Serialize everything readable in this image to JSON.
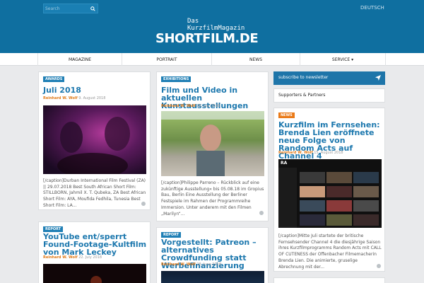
{
  "header": {
    "search_placeholder": "Search",
    "language": "DEUTSCH",
    "logo_line1": "Das",
    "logo_line2": "KurzfilmMagazin",
    "logo_big": "SHORTFILM.DE"
  },
  "nav": [
    "MAGAZINE",
    "PORTRAIT",
    "NEWS",
    "SERVICE ▾"
  ],
  "cards": {
    "c1": {
      "badge": "AWARDS",
      "title": "Juli 2018",
      "author": "Reinhard W. Wolf",
      "date": "9. August 2018",
      "excerpt": "[/caption]Durban International Film Festival (ZA) || 29.07.2018 Best South African Short Film: STILLBORN, Jahmil X. T. Qubeka, ZA Best African Short Film: AYA, Moufida Fedhila, Tunesia Best Short Film: LA..."
    },
    "c2": {
      "badge": "EXHIBITIONS",
      "title": "Film und Video in aktuellen Kunstausstellungen",
      "author": "Reinhard W. Wolf",
      "date": "28. July 2018",
      "excerpt": "[/caption]Philippe Parreno – Rückblick auf eine zukünftige Ausstellung« bis 05.08.18 im Gropius Bau, Berlin Eine Ausstellung der Berliner Festspiele im Rahmen der Programmreihe Immersion. Unter anderem mit den Filmen „Marilyn“..."
    },
    "c3": {
      "badge": "REPORT",
      "title": "YouTube ent/sperrt Found-Footage-Kultfilm von Mark Leckey",
      "author": "Reinhard W. Wolf",
      "date": "22. July 2018"
    },
    "c4": {
      "badge": "REPORT",
      "title": "Vorgestellt: Patreon – alternatives Crowdfunding statt Werbefinanzierung",
      "author": "Reinhard W. Wolf",
      "date": "28. June 2018"
    },
    "c5": {
      "badge": "NEWS",
      "title": "Kurzfilm im Fernsehen: Brenda Lien eröffnete neue Folge von Random Acts auf Channel 4",
      "author": "Reinhard W. Wolf",
      "date": "15. August 2018",
      "excerpt": "[/caption]Mitte Juli startete der britische Fernsehsender Channel 4 die diesjährige Saison ihres Kurzfilmprogramms Random Acts mit CALL OF CUTENESS der Offenbacher Filmemacherin Brenda Lien. Die animierte, gruselige Abrechnung mit der..."
    }
  },
  "sidebar": {
    "newsletter": "subscribe to newsletter",
    "supporters": "Supporters & Partners",
    "ra_label": "RA"
  },
  "colors": {
    "brand_blue": "#0f6fa0",
    "link_blue": "#1d78ae",
    "accent_orange": "#e07a18"
  }
}
